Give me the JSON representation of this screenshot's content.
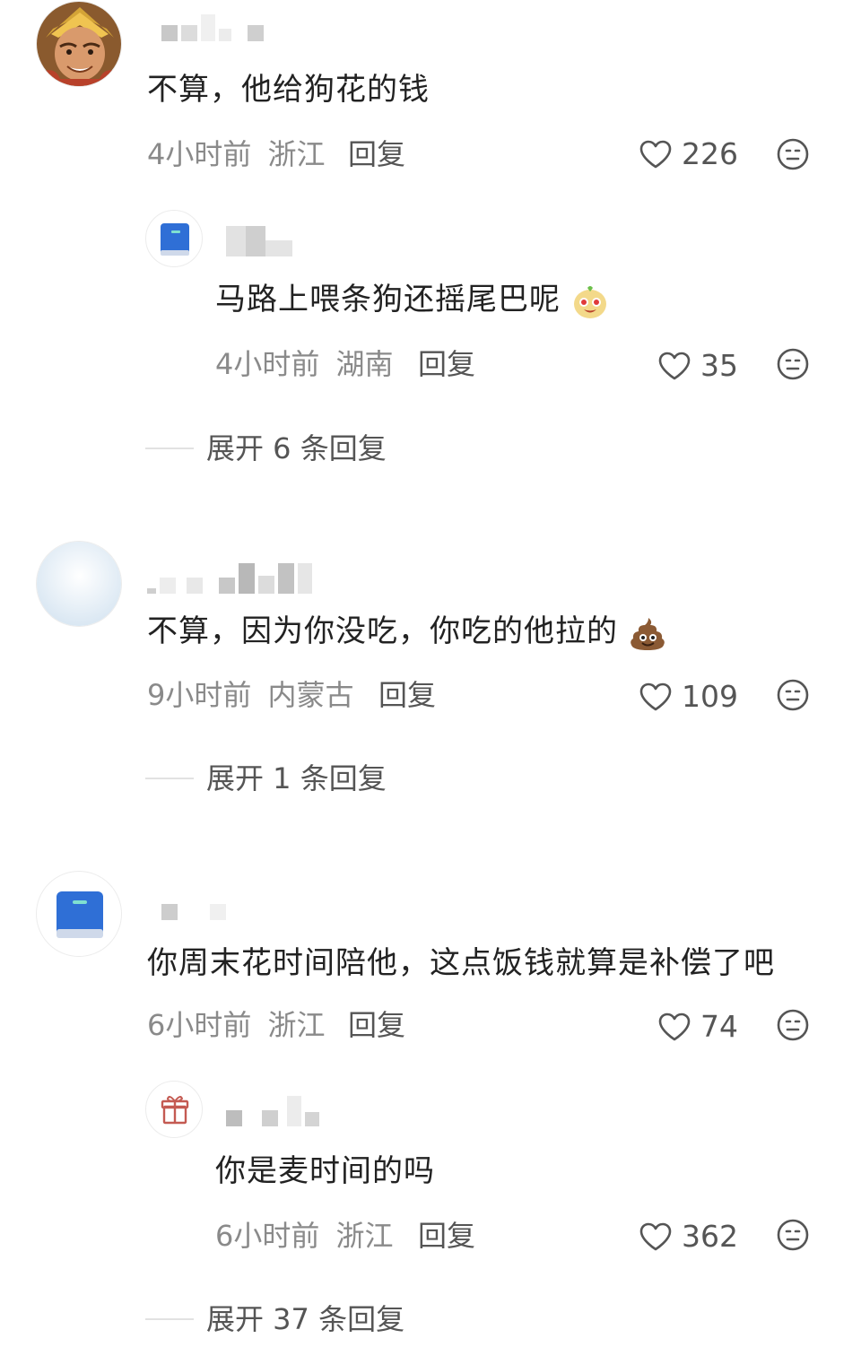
{
  "comments": [
    {
      "text": "不算，他给狗花的钱",
      "time": "4小时前",
      "location": "浙江",
      "reply_label": "回复",
      "likes": "226",
      "replies": [
        {
          "text": "马路上喂条狗还摇尾巴呢",
          "emoji": "happy-face-emoji",
          "time": "4小时前",
          "location": "湖南",
          "reply_label": "回复",
          "likes": "35"
        }
      ],
      "expand_label": "展开 6 条回复"
    },
    {
      "text": "不算，因为你没吃，你吃的他拉的",
      "emoji": "poop-emoji",
      "time": "9小时前",
      "location": "内蒙古",
      "reply_label": "回复",
      "likes": "109",
      "expand_label": "展开 1 条回复"
    },
    {
      "text": "你周末花时间陪他，这点饭钱就算是补偿了吧",
      "time": "6小时前",
      "location": "浙江",
      "reply_label": "回复",
      "likes": "74",
      "replies": [
        {
          "text": "你是麦时间的吗",
          "time": "6小时前",
          "location": "浙江",
          "reply_label": "回复",
          "likes": "362"
        }
      ],
      "expand_label": "展开 37 条回复"
    }
  ],
  "icons": {
    "like": "heart-outline-icon",
    "react": "smiley-face-icon"
  },
  "colors": {
    "text_primary": "#222222",
    "text_meta": "#8a8a8a",
    "text_secondary": "#555555"
  }
}
